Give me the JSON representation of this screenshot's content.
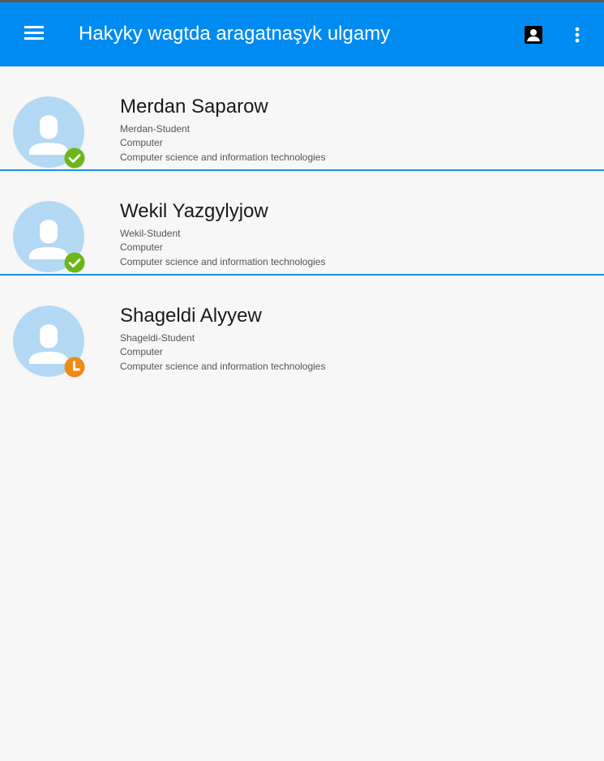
{
  "appbar": {
    "title": "Hakyky wagtda aragatnaşyk ulgamy",
    "background_color": "#008bf2",
    "icons": [
      "menu-icon",
      "contact-card-icon",
      "more-vert-icon"
    ]
  },
  "contacts": [
    {
      "name": "Merdan Saparow",
      "role": "Merdan-Student",
      "department": "Computer",
      "faculty": "Computer science and information technologies",
      "status": "online",
      "status_icon": "check-icon",
      "status_color": "#6cb618"
    },
    {
      "name": "Wekil Yazgylyjow",
      "role": "Wekil-Student",
      "department": "Computer",
      "faculty": "Computer science and information technologies",
      "status": "online",
      "status_icon": "check-icon",
      "status_color": "#6cb618"
    },
    {
      "name": "Shageldi Alyyew",
      "role": "Shageldi-Student",
      "department": "Computer",
      "faculty": "Computer science and information technologies",
      "status": "away",
      "status_icon": "clock-icon",
      "status_color": "#ef8a14"
    }
  ],
  "colors": {
    "divider": "#1e8ee6",
    "avatar_bg": "#b3d9f4",
    "avatar_fg": "#ffffff"
  }
}
